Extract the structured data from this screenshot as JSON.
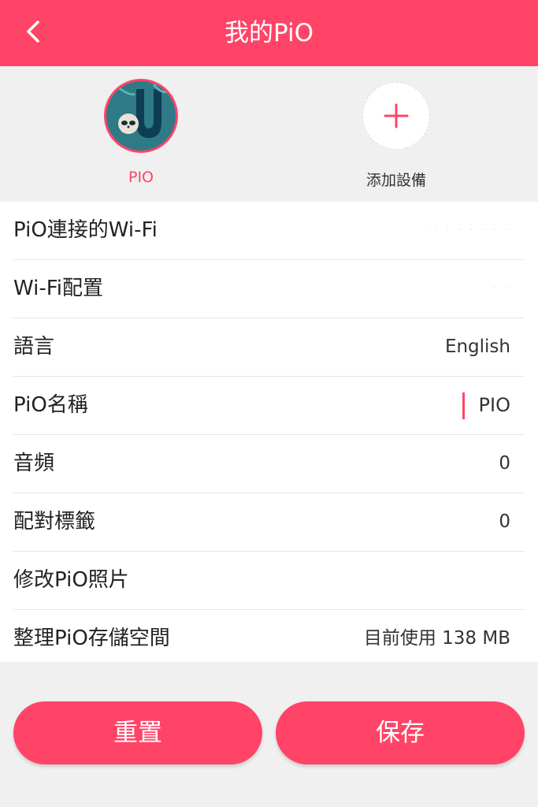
{
  "header": {
    "title": "我的PiO",
    "back_icon": "chevron-left-icon"
  },
  "devices": [
    {
      "label": "PIO",
      "icon": "sloth-avatar"
    },
    {
      "label": "添加設備",
      "icon": "plus-icon"
    }
  ],
  "settings": {
    "wifi_connected": {
      "label": "PiO連接的Wi-Fi",
      "value": "· · · · · · · ·"
    },
    "wifi_config": {
      "label": "Wi-Fi配置",
      "value": "· ·"
    },
    "language": {
      "label": "語言",
      "value": "English"
    },
    "name": {
      "label": "PiO名稱",
      "value": "PIO"
    },
    "audio": {
      "label": "音頻",
      "value": "0"
    },
    "pair_tag": {
      "label": "配對標籤",
      "value": "0"
    },
    "photo": {
      "label": "修改PiO照片"
    },
    "storage": {
      "label": "整理PiO存儲空間",
      "value": "目前使用 138 MB"
    }
  },
  "buttons": {
    "reset": "重置",
    "save": "保存"
  },
  "colors": {
    "accent": "#ff4468",
    "background": "#f0f0f0",
    "avatar_bg": "#2e7a86"
  }
}
